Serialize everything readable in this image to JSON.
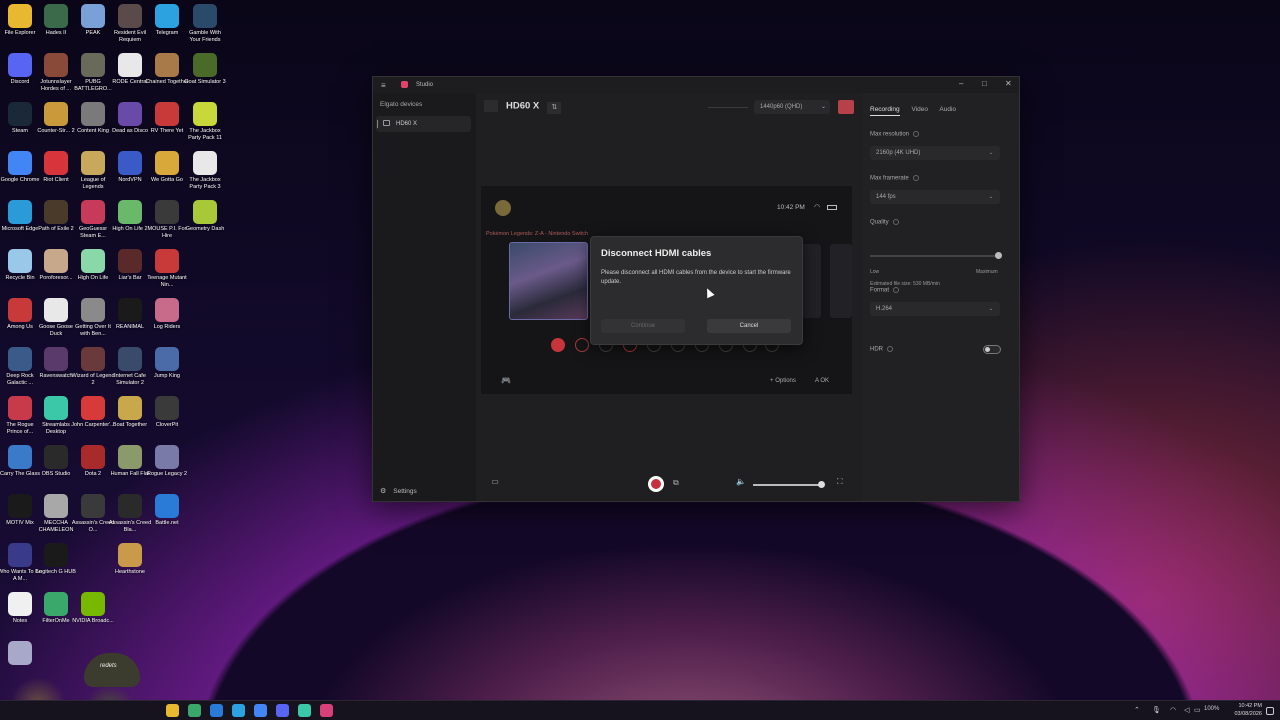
{
  "desktop_icons": [
    {
      "label": "File Explorer",
      "color": "#e8b830"
    },
    {
      "label": "Hades II",
      "color": "#3a6a4a"
    },
    {
      "label": "PEAK",
      "color": "#7aa0d8"
    },
    {
      "label": "Resident Evil Requiem",
      "color": "#5a4a4a"
    },
    {
      "label": "Telegram",
      "color": "#2ca3e0"
    },
    {
      "label": "Gamble With Your Friends",
      "color": "#2a4a6a"
    },
    {
      "label": "Discord",
      "color": "#5865f2"
    },
    {
      "label": "Jotunnslayer Hordes of ...",
      "color": "#8a4a3a"
    },
    {
      "label": "PUBG BATTLEGRO...",
      "color": "#6a6a5a"
    },
    {
      "label": "RODE Central",
      "color": "#e8e8e8"
    },
    {
      "label": "Chained Together",
      "color": "#a87a4a"
    },
    {
      "label": "Goat Simulator 3",
      "color": "#4a6a2a"
    },
    {
      "label": "Steam",
      "color": "#1b2838"
    },
    {
      "label": "Counter-Str... 2",
      "color": "#c89a3a"
    },
    {
      "label": "Content King",
      "color": "#7a7a7a"
    },
    {
      "label": "Dead as Disco",
      "color": "#6a4aa8"
    },
    {
      "label": "RV There Yet",
      "color": "#c83a3a"
    },
    {
      "label": "The Jackbox Party Pack 11",
      "color": "#c8d83a"
    },
    {
      "label": "Google Chrome",
      "color": "#4285f4"
    },
    {
      "label": "Riot Client",
      "color": "#d8343c"
    },
    {
      "label": "League of Legends",
      "color": "#c8a85a"
    },
    {
      "label": "NordVPN",
      "color": "#3a5ac8"
    },
    {
      "label": "We Gotta Go",
      "color": "#d8a83a"
    },
    {
      "label": "The Jackbox Party Pack 3",
      "color": "#e8e8e8"
    },
    {
      "label": "Microsoft Edge",
      "color": "#2a9ad8"
    },
    {
      "label": "Path of Exile 2",
      "color": "#4a3a2a"
    },
    {
      "label": "GeoGuessr Steam E...",
      "color": "#c83a5a"
    },
    {
      "label": "High On Life 2",
      "color": "#6ab86a"
    },
    {
      "label": "MOUSE P.I. For Hire",
      "color": "#3a3a3a"
    },
    {
      "label": "Geometry Dash",
      "color": "#a8c83a"
    },
    {
      "label": "Recycle Bin",
      "color": "#9ac8e8"
    },
    {
      "label": "Poroforesor...",
      "color": "#c8a88a"
    },
    {
      "label": "High On Life",
      "color": "#8ad8a8"
    },
    {
      "label": "Liar's Bar",
      "color": "#5a2a2a"
    },
    {
      "label": "Teenage Mutant Nin...",
      "color": "#c83a3a"
    },
    {
      "label": "Among Us",
      "color": "#c83a3a"
    },
    {
      "label": "Goose Goose Duck",
      "color": "#e8e8e8"
    },
    {
      "label": "Getting Over It with Ben...",
      "color": "#8a8a8a"
    },
    {
      "label": "REANIMAL",
      "color": "#1a1a1a"
    },
    {
      "label": "Log Riders",
      "color": "#c86a8a"
    },
    {
      "label": "Deep Rock Galactic ...",
      "color": "#3a5a8a"
    },
    {
      "label": "Ravenswatch",
      "color": "#5a3a6a"
    },
    {
      "label": "Wizard of Legend 2",
      "color": "#6a3a3a"
    },
    {
      "label": "Internet Cafe Simulator 2",
      "color": "#3a4a6a"
    },
    {
      "label": "Jump King",
      "color": "#4a6aa8"
    },
    {
      "label": "The Rogue Prince of...",
      "color": "#c83a4a"
    },
    {
      "label": "Streamlabs Desktop",
      "color": "#3ac8a8"
    },
    {
      "label": "John Carpenter'...",
      "color": "#d83a3a"
    },
    {
      "label": "Boat Together",
      "color": "#c8a84a"
    },
    {
      "label": "CloverPit",
      "color": "#3a3a3a"
    },
    {
      "label": "Carry The Glass",
      "color": "#3a7ac8"
    },
    {
      "label": "OBS Studio",
      "color": "#2a2a2a"
    },
    {
      "label": "Dota 2",
      "color": "#a82a2a"
    },
    {
      "label": "Human Fall Flat",
      "color": "#8a9a6a"
    },
    {
      "label": "Rogue Legacy 2",
      "color": "#7a7aa8"
    },
    {
      "label": "MOTIV Mix",
      "color": "#1a1a1a"
    },
    {
      "label": "MECCHA CHAMELEON",
      "color": "#a8a8a8"
    },
    {
      "label": "Assassin's Creed O...",
      "color": "#3a3a3a"
    },
    {
      "label": "Assassin's Creed Bla...",
      "color": "#2a2a2a"
    },
    {
      "label": "Battle.net",
      "color": "#2a7ad8"
    },
    {
      "label": "Who Wants To Be A M...",
      "color": "#3a3a8a"
    },
    {
      "label": "Logitech G HUB",
      "color": "#1a1a1a"
    },
    {
      "label": "Hearthstone",
      "color": "#c89a4a"
    },
    {
      "label": "Notes",
      "color": "#f0f0f0"
    },
    {
      "label": "FilterOnMe",
      "color": "#3aa86a"
    },
    {
      "label": "NVIDIA Broadc...",
      "color": "#76b900"
    },
    {
      "label": "",
      "color": "#a8a8c8"
    }
  ],
  "window": {
    "app_title": "Studio",
    "minimize_glyph": "–",
    "maximize_glyph": "□",
    "close_glyph": "✕",
    "menu_glyph": "≡",
    "sidebar": {
      "header": "Elgato devices",
      "device_label": "HD60 X",
      "settings_label": "Settings",
      "settings_glyph": "⚙"
    },
    "main": {
      "device_title": "HD60 X",
      "filter_glyph": "⇅",
      "resolution_dropdown": "1440p60 (QHD)",
      "dropdown_glyph": "⌄"
    },
    "preview": {
      "clock": "10:42",
      "clock_suffix": "PM",
      "wifi_glyph": "◠",
      "game_title": "Pokémon Legends: Z-A - Nintendo Switch",
      "controller_glyph": "🎮",
      "options_label": "Options",
      "ok_label": "OK",
      "options_glyph": "+",
      "ok_glyph": "A"
    },
    "bottombar": {
      "folder_glyph": "▭",
      "snapshot_glyph": "⧉",
      "volume_glyph": "🔈",
      "fullscreen_glyph": "⛶",
      "volume_level": 0.97
    },
    "right_panel": {
      "tabs": [
        "Recording",
        "Video",
        "Audio"
      ],
      "active_tab": 0,
      "max_resolution_label": "Max resolution",
      "max_resolution_value": "2160p (4K UHD)",
      "max_framerate_label": "Max framerate",
      "max_framerate_value": "144 fps",
      "quality_label": "Quality",
      "quality_low": "Low",
      "quality_max": "Maximum",
      "quality_level": 1.0,
      "file_size_text": "Estimated file size: 530 MB/min",
      "format_label": "Format",
      "format_value": "H.264",
      "hdr_label": "HDR",
      "hdr_enabled": false
    }
  },
  "modal": {
    "title": "Disconnect HDMI cables",
    "message": "Please disconnect all HDMI cables from the device to start the firmware update.",
    "continue_label": "Continue",
    "cancel_label": "Cancel"
  },
  "webcam": {
    "hat_text": "redets"
  },
  "taskbar": {
    "icon_colors": [
      "#e8b830",
      "#3aa86a",
      "#2a7ad8",
      "#2ca3e0",
      "#4285f4",
      "#5865f2",
      "#3ac8a8",
      "#d8407a"
    ],
    "tray_glyph": "⌃",
    "mic_glyph": "🎙",
    "battery_text": "100%",
    "time": "10:42 PM",
    "date": "03/08/2026"
  }
}
